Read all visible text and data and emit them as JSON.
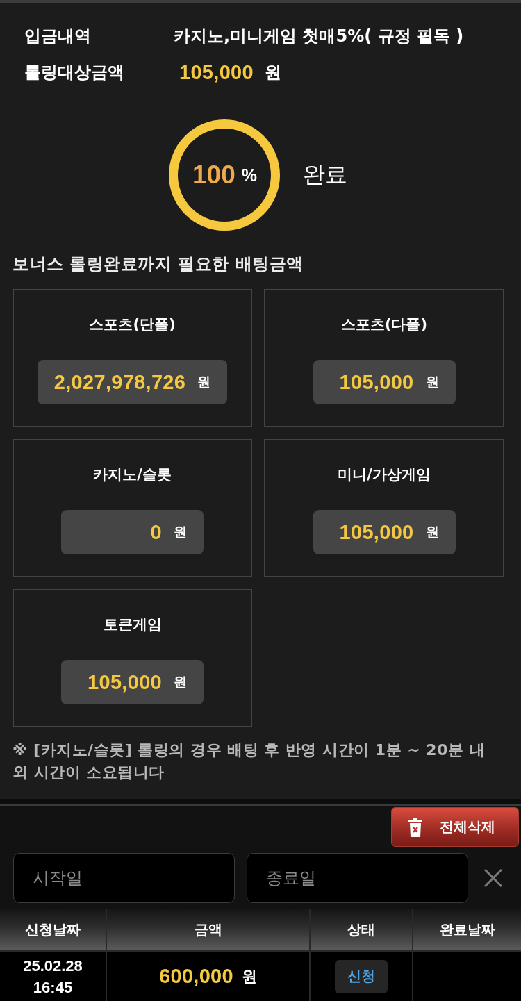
{
  "summary": [
    {
      "kind": "text",
      "label": "입금내역",
      "value": "카지노,미니게임 첫매5%( 규정 필독 )"
    },
    {
      "kind": "amount",
      "label": "롤링대상금액",
      "value": "105,000",
      "unit": "원"
    }
  ],
  "progress": {
    "level": 1,
    "value": "100",
    "unit": "%",
    "status": "완료"
  },
  "requirements": {
    "title": "보너스 롤링완료까지 필요한 배팅금액",
    "cards": [
      {
        "title": "스포츠(단폴)",
        "amount": "2,027,978,726",
        "unit": "원"
      },
      {
        "title": "스포츠(다폴)",
        "amount": "105,000",
        "unit": "원"
      },
      {
        "title": "카지노/슬롯",
        "amount": "0",
        "unit": "원"
      },
      {
        "title": "미니/가상게임",
        "amount": "105,000",
        "unit": "원"
      },
      {
        "title": "토큰게임",
        "amount": "105,000",
        "unit": "원"
      }
    ],
    "note": "※ [카지노/슬롯] 롤링의 경우 배팅 후 반영 시간이 1분 ~ 20분 내외 시간이 소요됩니다"
  },
  "history": {
    "delete_all_button": "전체삭제",
    "start_date": {
      "placeholder": "시작일"
    },
    "end_date": {
      "placeholder": "종료일"
    },
    "table": {
      "columns": [
        "신청날짜",
        "금액",
        "상태",
        "완료날짜"
      ],
      "rows": [
        {
          "requested_at": "25.02.28 16:45",
          "amount": "600,000",
          "unit": "원",
          "status": "신청"
        }
      ]
    }
  }
}
